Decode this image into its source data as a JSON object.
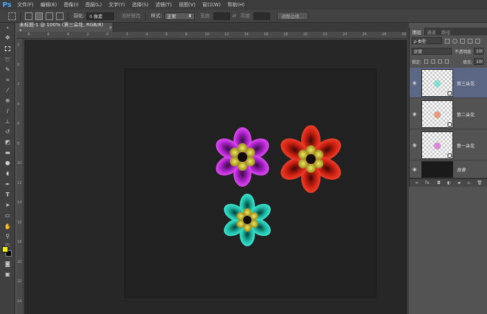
{
  "app": {
    "logo": "Ps",
    "menu": [
      "文件(F)",
      "编辑(E)",
      "图像(I)",
      "图层(L)",
      "文字(Y)",
      "选择(S)",
      "滤镜(T)",
      "视图(V)",
      "窗口(W)",
      "帮助(H)"
    ]
  },
  "options": {
    "feather_label": "羽化:",
    "feather_value": "0 像素",
    "antialias_label": "消除锯齿",
    "style_label": "样式:",
    "style_value": "正常",
    "width_label": "宽度:",
    "height_label": "高度:",
    "refine_edge": "调整边缘..."
  },
  "document": {
    "tab_title": "未标题-1 @ 100% (第三朵花, RGB/8) *",
    "close": "×"
  },
  "rulers": {
    "top": [
      "8",
      "6",
      "4",
      "2",
      "0",
      "2",
      "4",
      "6",
      "8",
      "10",
      "12",
      "14",
      "16",
      "18",
      "20",
      "22",
      "24",
      "26",
      "28",
      "30"
    ],
    "left": [
      "2",
      "0",
      "2",
      "4",
      "6",
      "8",
      "10",
      "12",
      "14",
      "16",
      "18",
      "20",
      "22",
      "24"
    ]
  },
  "layers_panel": {
    "tabs": [
      "图层",
      "通道",
      "路径"
    ],
    "filter_kind": "ρ 类型",
    "blend_mode": "正常",
    "opacity_label": "不透明度:",
    "opacity_value": "100%",
    "lock_label": "锁定:",
    "fill_label": "填充:",
    "fill_value": "100%",
    "layers": [
      {
        "name": "第三朵花",
        "selected": true,
        "accent": "#3fd7c4"
      },
      {
        "name": "第二朵花",
        "selected": false,
        "accent": "#e8693a"
      },
      {
        "name": "第一朵花",
        "selected": false,
        "accent": "#d84ad6"
      },
      {
        "name": "背景",
        "selected": false,
        "accent": "#1a1a1a"
      }
    ],
    "footer_icons": [
      "link-icon",
      "fx-icon",
      "mask-icon",
      "adjustment-icon",
      "group-icon",
      "new-layer-icon",
      "trash-icon"
    ],
    "footer_fx": "fx."
  },
  "colors": {
    "foreground": "#f1f20f",
    "background": "#000000",
    "flower_purple": "#c930e6",
    "flower_red": "#e42a1a",
    "flower_teal": "#27d6c0",
    "flower_center": "#d6c834"
  }
}
